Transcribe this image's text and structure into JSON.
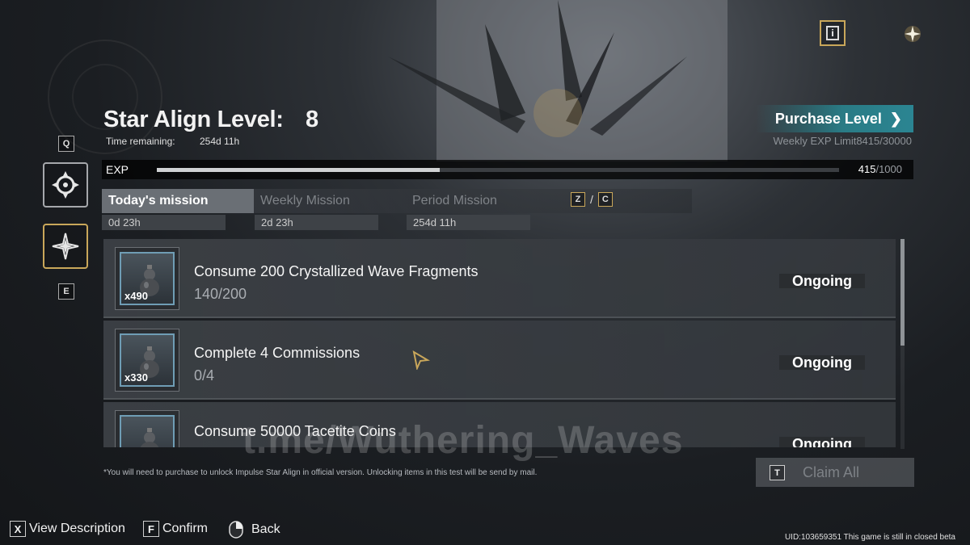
{
  "header": {
    "title": "Star Align Level:",
    "level": "8",
    "time_label": "Time remaining:",
    "time_value": "254d 11h",
    "purchase_label": "Purchase Level",
    "weekly_exp": "Weekly EXP Limit8415/30000"
  },
  "exp": {
    "label": "EXP",
    "current": "415",
    "max": "/1000",
    "progress": 0.415
  },
  "side": {
    "key_top": "Q",
    "key_bottom": "E"
  },
  "tabs": [
    {
      "label": "Today's mission",
      "time": "0d 23h",
      "active": true
    },
    {
      "label": "Weekly Mission",
      "time": "2d 23h",
      "active": false
    },
    {
      "label": "Period Mission",
      "time": "254d 11h",
      "active": false
    }
  ],
  "tab_keys": {
    "left": "Z",
    "sep": "/",
    "right": "C"
  },
  "missions": [
    {
      "title": "Consume 200 Crystallized Wave Fragments",
      "progress": "140/200",
      "qty": "x490",
      "status": "Ongoing"
    },
    {
      "title": "Complete 4 Commissions",
      "progress": "0/4",
      "qty": "x330",
      "status": "Ongoing"
    },
    {
      "title": "Consume 50000 Tacetite Coins",
      "progress": "",
      "qty": "",
      "status": "Ongoing"
    }
  ],
  "watermark": "t.me/Wuthering_Waves",
  "footnote": "*You will need to purchase to unlock Impulse Star Align in official version. Unlocking items in this test will be send by mail.",
  "claim": {
    "key": "T",
    "label": "Claim All"
  },
  "controls": {
    "view_key": "X",
    "view_label": "View Description",
    "confirm_key": "F",
    "confirm_label": "Confirm",
    "back_label": "Back"
  },
  "uid_text": "UID:103659351  This game is still in closed beta",
  "colors": {
    "accent_gold": "#c9a75a",
    "purchase_teal": "#2b8592",
    "thumb_border": "#6f9db5"
  }
}
